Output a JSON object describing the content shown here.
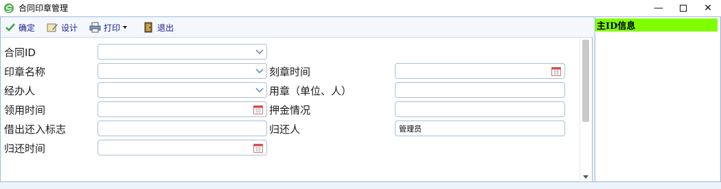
{
  "window": {
    "title": "合同印章管理"
  },
  "toolbar": {
    "ok_label": "确定",
    "design_label": "设计",
    "print_label": "打印",
    "exit_label": "退出"
  },
  "form": {
    "contract_id_label": "合同ID",
    "seal_name_label": "印章名称",
    "handler_label": "经办人",
    "receive_time_label": "领用时间",
    "borrow_flag_label": "借出还入标志",
    "return_time_label": "归还时间",
    "engrave_time_label": "刻章时间",
    "seal_user_label": "用章（单位、人）",
    "deposit_label": "押金情况",
    "returner_label": "归还人",
    "returner_value": "管理员"
  },
  "side_panel": {
    "header": "主ID信息"
  },
  "colors": {
    "side_header_bg": "#80ff00",
    "border": "#9db9dc",
    "toolbar_text": "#1a1a8c"
  }
}
